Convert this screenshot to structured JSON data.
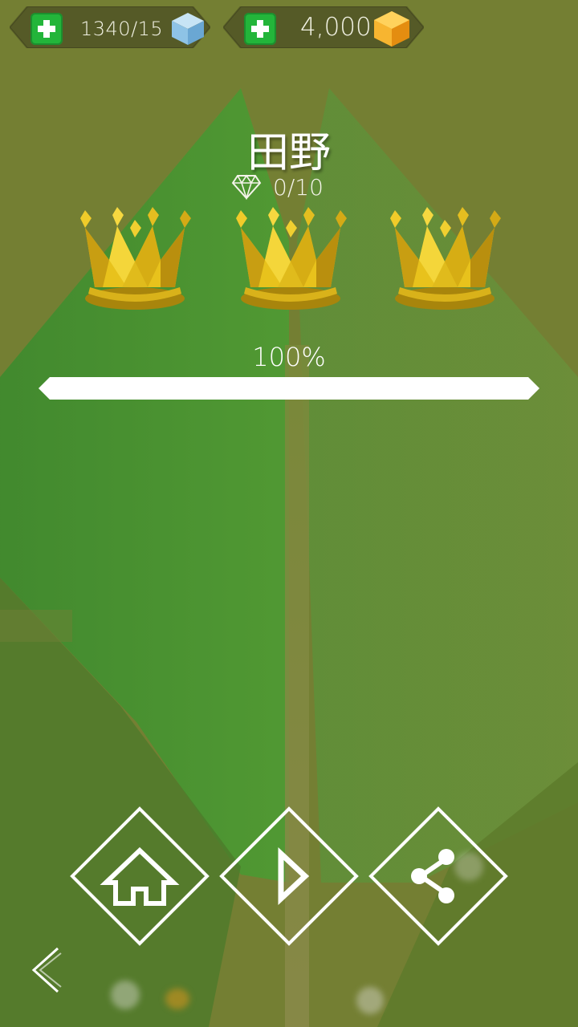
{
  "resources": {
    "cubes": {
      "value": "1340/15",
      "icon": "ice-cube-icon",
      "color": "#8ec3e6"
    },
    "gold": {
      "value": "4,000",
      "icon": "gold-gem-icon",
      "color": "#f3a81c"
    }
  },
  "level": {
    "title": "田野",
    "diamonds": "0/10",
    "crowns_earned": 3,
    "crowns_total": 3
  },
  "progress": {
    "label": "100%",
    "value": 1.0
  },
  "buttons": {
    "home": "home-icon",
    "play": "play-icon",
    "share": "share-icon",
    "back": "back-chevron-icon"
  },
  "colors": {
    "accent_green": "#23b53a",
    "crown_gold": "#e8c21c",
    "white": "#ffffff"
  }
}
